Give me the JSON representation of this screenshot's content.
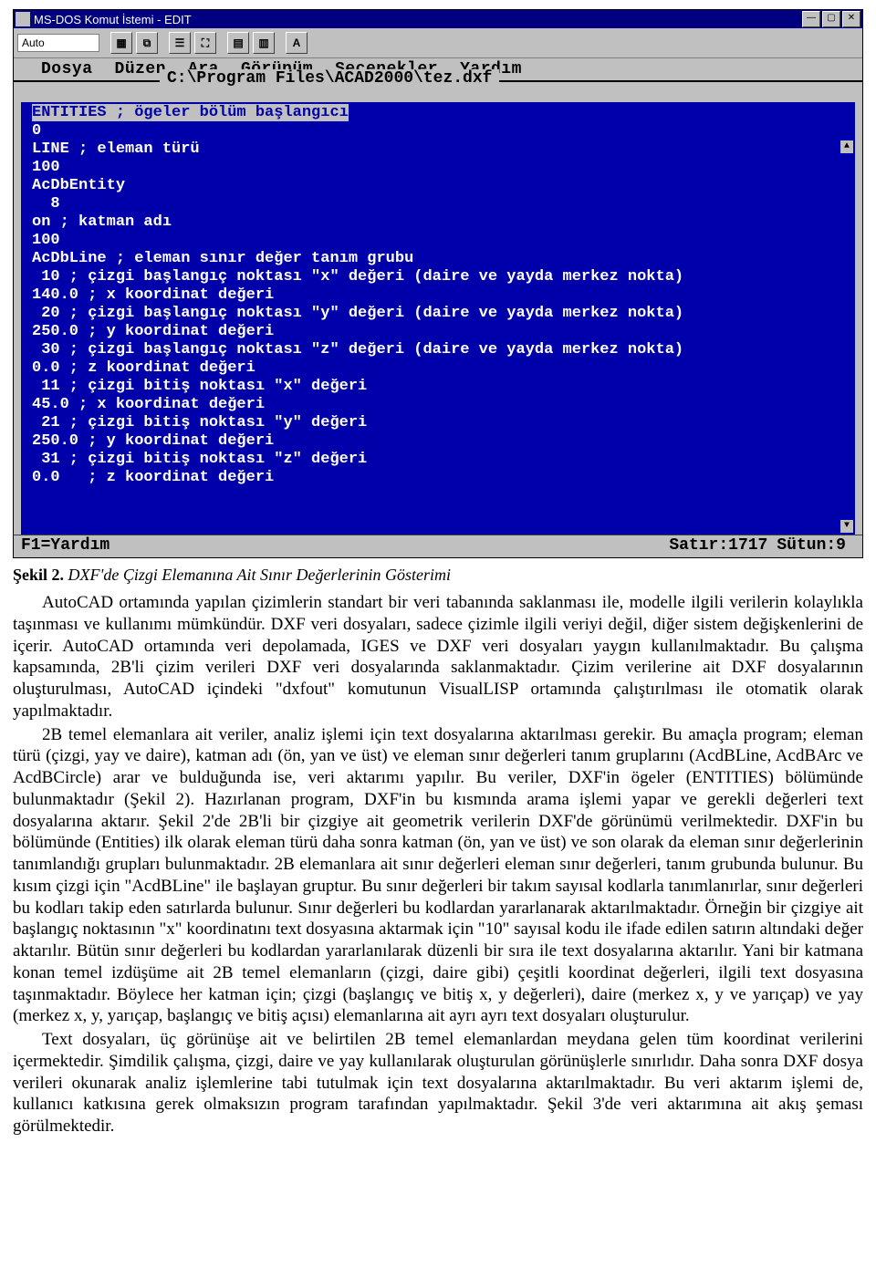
{
  "window": {
    "title": "MS-DOS Komut İstemi - EDIT",
    "min_glyph": "—",
    "max_glyph": "▢",
    "close_glyph": "✕"
  },
  "toolbar": {
    "auto_label": "Auto",
    "a_glyph": "A"
  },
  "dos_menu": {
    "items": [
      "Dosya",
      "Düzen",
      "Ara",
      "Görünüm",
      "Seçenekler",
      "Yardım"
    ]
  },
  "dos_path": "C:\\Program Files\\ACAD2000\\tez.dxf",
  "dxf_lines": [
    "ENTITIES ; ögeler bölüm başlangıcı",
    "0",
    "LINE ; eleman türü",
    "100",
    "AcDbEntity",
    "  8",
    "on ; katman adı",
    "100",
    "AcDbLine ; eleman sınır değer tanım grubu",
    " 10 ; çizgi başlangıç noktası \"x\" değeri (daire ve yayda merkez nokta)",
    "140.0 ; x koordinat değeri",
    " 20 ; çizgi başlangıç noktası \"y\" değeri (daire ve yayda merkez nokta)",
    "250.0 ; y koordinat değeri",
    " 30 ; çizgi başlangıç noktası \"z\" değeri (daire ve yayda merkez nokta)",
    "0.0 ; z koordinat değeri",
    " 11 ; çizgi bitiş noktası \"x\" değeri",
    "45.0 ; x koordinat değeri",
    " 21 ; çizgi bitiş noktası \"y\" değeri",
    "250.0 ; y koordinat değeri",
    " 31 ; çizgi bitiş noktası \"z\" değeri",
    "0.0   ; z koordinat değeri"
  ],
  "dos_status": {
    "help": "F1=Yardım",
    "line": "Satır:1717",
    "col": "Sütun:9"
  },
  "caption": {
    "bold": "Şekil 2.",
    "rest": " DXF'de Çizgi Elemanına Ait Sınır Değerlerinin Gösterimi"
  },
  "paragraphs": {
    "p1": "AutoCAD ortamında yapılan çizimlerin standart bir veri tabanında saklanması ile, modelle ilgili verilerin kolaylıkla taşınması ve kullanımı mümkündür. DXF veri dosyaları, sadece çizimle ilgili veriyi değil, diğer sistem değişkenlerini de içerir. AutoCAD ortamında veri depolamada, IGES ve DXF veri dosyaları yaygın kullanılmaktadır. Bu çalışma kapsamında, 2B'li çizim verileri DXF veri dosyalarında saklanmaktadır. Çizim verilerine ait DXF dosyalarının oluşturulması, AutoCAD içindeki \"dxfout\" komutunun VisualLISP ortamında çalıştırılması ile otomatik olarak yapılmaktadır.",
    "p2": "2B temel elemanlara ait veriler, analiz işlemi için text dosyalarına aktarılması gerekir. Bu amaçla program; eleman türü (çizgi, yay ve daire), katman adı (ön, yan ve üst) ve eleman sınır değerleri tanım gruplarını (AcdBLine, AcdBArc ve AcdBCircle) arar ve bulduğunda ise, veri aktarımı yapılır. Bu veriler, DXF'in ögeler (ENTITIES) bölümünde bulunmaktadır (Şekil 2). Hazırlanan program, DXF'in bu kısmında arama işlemi yapar ve gerekli değerleri text dosyalarına aktarır. Şekil 2'de 2B'li bir çizgiye ait geometrik verilerin DXF'de görünümü verilmektedir. DXF'in bu bölümünde (Entities) ilk olarak eleman türü daha sonra katman (ön, yan ve üst) ve son olarak da eleman sınır değerlerinin tanımlandığı grupları bulunmaktadır. 2B elemanlara ait sınır değerleri eleman sınır değerleri, tanım grubunda bulunur. Bu kısım çizgi için \"AcdBLine\" ile başlayan gruptur. Bu sınır değerleri bir takım sayısal kodlarla tanımlanırlar, sınır değerleri bu kodları takip eden satırlarda bulunur. Sınır değerleri bu kodlardan yararlanarak aktarılmaktadır. Örneğin bir çizgiye ait başlangıç noktasının \"x\" koordinatını text dosyasına aktarmak için \"10\" sayısal kodu ile ifade edilen satırın altındaki değer aktarılır. Bütün sınır değerleri bu kodlardan yararlanılarak düzenli bir sıra ile text dosyalarına aktarılır. Yani bir katmana konan temel izdüşüme ait 2B temel elemanların (çizgi, daire gibi) çeşitli koordinat değerleri, ilgili text dosyasına taşınmaktadır. Böylece her katman için; çizgi (başlangıç ve bitiş x, y değerleri), daire (merkez x, y ve yarıçap) ve yay (merkez x, y, yarıçap, başlangıç ve bitiş açısı) elemanlarına ait ayrı ayrı text dosyaları oluşturulur.",
    "p3": "Text dosyaları, üç görünüşe ait ve belirtilen 2B temel elemanlardan meydana gelen tüm koordinat verilerini içermektedir. Şimdilik çalışma, çizgi, daire ve yay kullanılarak oluşturulan görünüşlerle sınırlıdır. Daha sonra DXF dosya verileri okunarak analiz işlemlerine tabi tutulmak için text dosyalarına aktarılmaktadır. Bu veri aktarım işlemi de, kullanıcı katkısına gerek olmaksızın program tarafından yapılmaktadır. Şekil 3'de veri aktarımına ait akış şeması görülmektedir."
  }
}
